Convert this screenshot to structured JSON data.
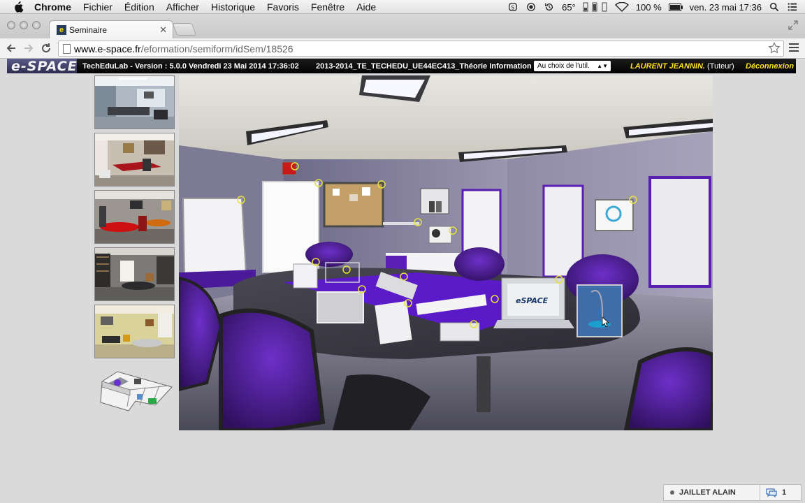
{
  "menubar": {
    "app": "Chrome",
    "items": [
      "Fichier",
      "Édition",
      "Afficher",
      "Historique",
      "Favoris",
      "Fenêtre",
      "Aide"
    ],
    "temperature": "65°",
    "battery": "100 %",
    "datetime": "ven. 23 mai  17:36"
  },
  "tab": {
    "title": "Seminaire",
    "favicon": "e"
  },
  "address": {
    "host": "www.e-space.fr",
    "path": "/eformation/semiform/idSem/18526"
  },
  "appbar": {
    "logo": "e-SPACE",
    "version": "TechEduLab - Version : 5.0.0 Vendredi 23 Mai 2014   17:36:02",
    "course": "2013-2014_TE_TECHEDU_UE44EC413_Théorie Information",
    "dropdown": "Au choix de l'util.",
    "user": "LAURENT JEANNIN.",
    "role": "(Tuteur)",
    "logout": "Déconnexion"
  },
  "thumbnails": [
    "bureau-accueil",
    "bureau-rouge",
    "salle-ronde",
    "bibliotheque",
    "salle-jaune"
  ],
  "chat": {
    "user": "JAILLET ALAIN",
    "count": "1"
  },
  "colors": {
    "accent": "#5a1fb0",
    "wall": "#8f8aa5",
    "appbar": "#000000",
    "highlight": "#ffe227"
  }
}
